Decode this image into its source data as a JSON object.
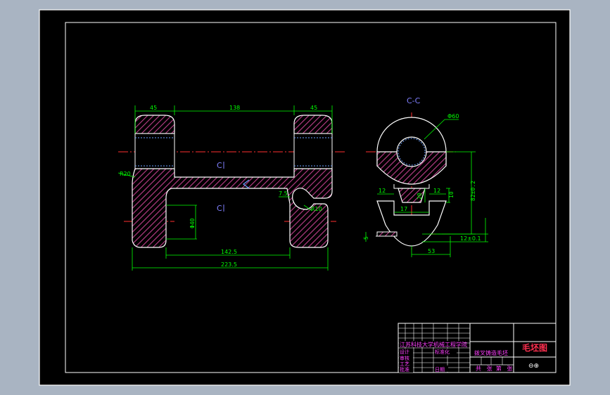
{
  "drawing": {
    "front_view": {
      "dimensions": {
        "left_boss_width": "45",
        "span": "138",
        "right_boss_width": "45",
        "bore_diameter": "Φ40",
        "inner_length": "142.5",
        "overall_length": "223.5",
        "hook_offset": "7.5",
        "left_radius": "R20",
        "hook_radius": "R10"
      },
      "section_marks": {
        "upper": "C",
        "lower": "C"
      }
    },
    "side_view": {
      "title": "C-C",
      "dimensions": {
        "hole_diameter": "Φ60",
        "slot_left": "12",
        "slot_depth": "20",
        "slot_right": "12",
        "slot_height": "10",
        "slot_width": "17",
        "height_to_axis": "82±0.2",
        "base_offset": "5",
        "base_width": "53",
        "base_thickness": "12±0.1"
      }
    },
    "title_block": {
      "drawing_name": "毛坯图",
      "part_name": "拨叉铸造毛坯",
      "school_line": "江苏科技大学机械工程学院",
      "designer_label": "设计",
      "design_label": "标准化",
      "review_label": "审核",
      "approve_label": "批准",
      "process_label": "工艺",
      "date_label": "日期",
      "sheet_info": "共   张  第   张",
      "projection_symbol": "⊖⊕"
    }
  },
  "colors": {
    "background": "#000000",
    "frame": "#ffffff",
    "geometry": "#ffffff",
    "dimension": "#00ff00",
    "center_line": "#ff3030",
    "hatch": "#c0408c",
    "label": "#8080ff",
    "title_text": "#ff40ff",
    "title_red": "#ff3050"
  }
}
